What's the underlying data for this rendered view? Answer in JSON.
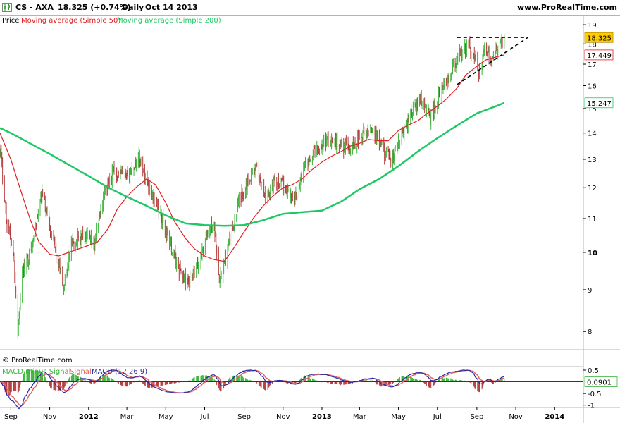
{
  "header": {
    "instrument": "CS - AXA",
    "quote": "18.325 (+0.74%)",
    "period": "Daily",
    "date": "Oct 14 2013",
    "site": "www.ProRealTime.com"
  },
  "legend": {
    "price": "Price",
    "ma50": "Moving average (Simple 50)",
    "ma200": "Moving average (Simple 200)"
  },
  "watermark": "© ProRealTime.com",
  "macd_legend": {
    "hist": "MACD minus Signal",
    "signal": "Signal",
    "macd": "MACD (12 26 9)"
  },
  "colors": {
    "up": "#3cb43c",
    "down": "#b43c3c",
    "ma50": "#e01e1e",
    "ma200": "#1ec864",
    "macd": "#2828a0",
    "signal": "#e06464",
    "hist": "#3cb43c",
    "last_price_bg": "#ffcc00",
    "trendline": "#000000"
  },
  "chart_data": [
    {
      "type": "candlestick",
      "title": "CS - AXA",
      "x_range": [
        "2011-08-15",
        "2014-02-15"
      ],
      "ylim": [
        7.6,
        19.5
      ],
      "y_scale": "log",
      "y_ticks": [
        "8",
        "9",
        "10",
        "11",
        "12",
        "13",
        "14",
        "15",
        "16",
        "17",
        "18",
        "19"
      ],
      "y_ticks_bold": [
        "10"
      ],
      "x_ticks": [
        {
          "label": "Sep",
          "date": "2011-09-01"
        },
        {
          "label": "Nov",
          "date": "2011-11-01"
        },
        {
          "label": "2012",
          "date": "2012-01-01"
        },
        {
          "label": "Mar",
          "date": "2012-03-01"
        },
        {
          "label": "May",
          "date": "2012-05-01"
        },
        {
          "label": "Jul",
          "date": "2012-07-01"
        },
        {
          "label": "Sep",
          "date": "2012-09-01"
        },
        {
          "label": "Nov",
          "date": "2012-11-01"
        },
        {
          "label": "2013",
          "date": "2013-01-01"
        },
        {
          "label": "Mar",
          "date": "2013-03-01"
        },
        {
          "label": "May",
          "date": "2013-05-01"
        },
        {
          "label": "Jul",
          "date": "2013-07-01"
        },
        {
          "label": "Sep",
          "date": "2013-09-01"
        },
        {
          "label": "Nov",
          "date": "2013-11-01"
        },
        {
          "label": "2014",
          "date": "2014-01-01"
        }
      ],
      "x_ticks_bold": [
        "2012",
        "2013",
        "2014"
      ],
      "price_path": [
        [
          "2011-08-15",
          13.5
        ],
        [
          "2011-08-25",
          11.0
        ],
        [
          "2011-09-05",
          10.0
        ],
        [
          "2011-09-12",
          8.0
        ],
        [
          "2011-09-20",
          9.5
        ],
        [
          "2011-10-05",
          10.2
        ],
        [
          "2011-10-20",
          11.8
        ],
        [
          "2011-11-05",
          10.5
        ],
        [
          "2011-11-22",
          9.0
        ],
        [
          "2011-12-05",
          10.2
        ],
        [
          "2011-12-22",
          10.5
        ],
        [
          "2012-01-10",
          10.2
        ],
        [
          "2012-01-25",
          11.8
        ],
        [
          "2012-02-10",
          12.6
        ],
        [
          "2012-03-01",
          12.3
        ],
        [
          "2012-03-20",
          13.1
        ],
        [
          "2012-04-05",
          12.0
        ],
        [
          "2012-04-20",
          11.3
        ],
        [
          "2012-05-05",
          10.4
        ],
        [
          "2012-05-20",
          9.6
        ],
        [
          "2012-06-05",
          9.1
        ],
        [
          "2012-06-20",
          9.6
        ],
        [
          "2012-07-05",
          10.5
        ],
        [
          "2012-07-15",
          10.9
        ],
        [
          "2012-07-25",
          9.2
        ],
        [
          "2012-08-10",
          10.4
        ],
        [
          "2012-08-25",
          11.6
        ],
        [
          "2012-09-10",
          12.4
        ],
        [
          "2012-09-20",
          12.7
        ],
        [
          "2012-10-05",
          11.6
        ],
        [
          "2012-10-20",
          12.3
        ],
        [
          "2012-11-05",
          12.0
        ],
        [
          "2012-11-20",
          11.6
        ],
        [
          "2012-12-05",
          12.8
        ],
        [
          "2012-12-20",
          13.3
        ],
        [
          "2013-01-10",
          13.8
        ],
        [
          "2013-01-28",
          13.6
        ],
        [
          "2013-02-15",
          13.4
        ],
        [
          "2013-03-01",
          13.8
        ],
        [
          "2013-03-20",
          14.2
        ],
        [
          "2013-04-05",
          13.4
        ],
        [
          "2013-04-20",
          12.9
        ],
        [
          "2013-05-05",
          13.8
        ],
        [
          "2013-05-20",
          14.8
        ],
        [
          "2013-06-05",
          15.4
        ],
        [
          "2013-06-20",
          14.6
        ],
        [
          "2013-07-05",
          15.6
        ],
        [
          "2013-07-20",
          16.4
        ],
        [
          "2013-08-05",
          17.4
        ],
        [
          "2013-08-20",
          18.0
        ],
        [
          "2013-09-05",
          16.6
        ],
        [
          "2013-09-15",
          17.8
        ],
        [
          "2013-09-25",
          17.1
        ],
        [
          "2013-10-05",
          17.8
        ],
        [
          "2013-10-14",
          18.33
        ]
      ],
      "ma50_path": [
        [
          "2011-08-15",
          14.0
        ],
        [
          "2011-09-01",
          13.0
        ],
        [
          "2011-09-15",
          12.0
        ],
        [
          "2011-10-01",
          11.0
        ],
        [
          "2011-10-15",
          10.3
        ],
        [
          "2011-11-01",
          9.95
        ],
        [
          "2011-11-15",
          9.9
        ],
        [
          "2011-12-01",
          10.0
        ],
        [
          "2012-01-01",
          10.2
        ],
        [
          "2012-01-15",
          10.3
        ],
        [
          "2012-02-01",
          10.7
        ],
        [
          "2012-02-15",
          11.3
        ],
        [
          "2012-03-01",
          11.7
        ],
        [
          "2012-03-15",
          12.0
        ],
        [
          "2012-04-01",
          12.3
        ],
        [
          "2012-04-15",
          12.1
        ],
        [
          "2012-05-01",
          11.5
        ],
        [
          "2012-05-15",
          10.9
        ],
        [
          "2012-06-01",
          10.4
        ],
        [
          "2012-06-15",
          10.1
        ],
        [
          "2012-07-01",
          9.9
        ],
        [
          "2012-07-15",
          9.8
        ],
        [
          "2012-08-01",
          9.75
        ],
        [
          "2012-08-15",
          10.1
        ],
        [
          "2012-09-01",
          10.6
        ],
        [
          "2012-09-15",
          11.0
        ],
        [
          "2012-10-01",
          11.4
        ],
        [
          "2012-10-15",
          11.7
        ],
        [
          "2012-11-01",
          12.0
        ],
        [
          "2012-11-15",
          12.1
        ],
        [
          "2012-12-01",
          12.3
        ],
        [
          "2012-12-15",
          12.6
        ],
        [
          "2013-01-01",
          12.9
        ],
        [
          "2013-01-15",
          13.1
        ],
        [
          "2013-02-01",
          13.3
        ],
        [
          "2013-02-15",
          13.5
        ],
        [
          "2013-03-01",
          13.6
        ],
        [
          "2013-03-15",
          13.75
        ],
        [
          "2013-04-01",
          13.7
        ],
        [
          "2013-04-15",
          13.7
        ],
        [
          "2013-05-01",
          14.1
        ],
        [
          "2013-05-15",
          14.3
        ],
        [
          "2013-06-01",
          14.5
        ],
        [
          "2013-06-15",
          14.8
        ],
        [
          "2013-07-01",
          15.1
        ],
        [
          "2013-07-15",
          15.4
        ],
        [
          "2013-08-01",
          15.9
        ],
        [
          "2013-08-15",
          16.5
        ],
        [
          "2013-09-01",
          16.9
        ],
        [
          "2013-09-15",
          17.2
        ],
        [
          "2013-10-01",
          17.35
        ],
        [
          "2013-10-14",
          17.449
        ]
      ],
      "ma200_path": [
        [
          "2011-08-15",
          14.2
        ],
        [
          "2011-09-01",
          14.0
        ],
        [
          "2011-10-01",
          13.6
        ],
        [
          "2011-11-01",
          13.2
        ],
        [
          "2011-12-01",
          12.8
        ],
        [
          "2012-01-01",
          12.4
        ],
        [
          "2012-02-01",
          12.0
        ],
        [
          "2012-03-01",
          11.7
        ],
        [
          "2012-04-01",
          11.4
        ],
        [
          "2012-05-01",
          11.1
        ],
        [
          "2012-06-01",
          10.85
        ],
        [
          "2012-07-01",
          10.8
        ],
        [
          "2012-08-01",
          10.78
        ],
        [
          "2012-09-01",
          10.8
        ],
        [
          "2012-10-01",
          10.95
        ],
        [
          "2012-11-01",
          11.15
        ],
        [
          "2012-12-01",
          11.2
        ],
        [
          "2013-01-01",
          11.25
        ],
        [
          "2013-02-01",
          11.55
        ],
        [
          "2013-03-01",
          11.95
        ],
        [
          "2013-04-01",
          12.3
        ],
        [
          "2013-05-01",
          12.75
        ],
        [
          "2013-06-01",
          13.3
        ],
        [
          "2013-07-01",
          13.8
        ],
        [
          "2013-08-01",
          14.3
        ],
        [
          "2013-09-01",
          14.8
        ],
        [
          "2013-10-01",
          15.1
        ],
        [
          "2013-10-14",
          15.247
        ]
      ],
      "price_labels": [
        {
          "text": "18.325",
          "value": 18.325,
          "style": "last"
        },
        {
          "text": "17.449",
          "value": 17.449,
          "style": "ma50"
        },
        {
          "text": "15.247",
          "value": 15.247,
          "style": "ma200"
        }
      ],
      "trendlines": [
        {
          "from": [
            "2013-08-01",
            18.33
          ],
          "to": [
            "2013-11-20",
            18.33
          ]
        },
        {
          "from": [
            "2013-08-01",
            16.05
          ],
          "to": [
            "2013-11-20",
            18.33
          ]
        }
      ]
    },
    {
      "type": "macd",
      "title": "MACD (12 26 9)",
      "ylim": [
        -1.1,
        0.65
      ],
      "y_ticks": [
        "0.5",
        "-0.5",
        "-1"
      ],
      "last_value": "0.0901"
    }
  ]
}
